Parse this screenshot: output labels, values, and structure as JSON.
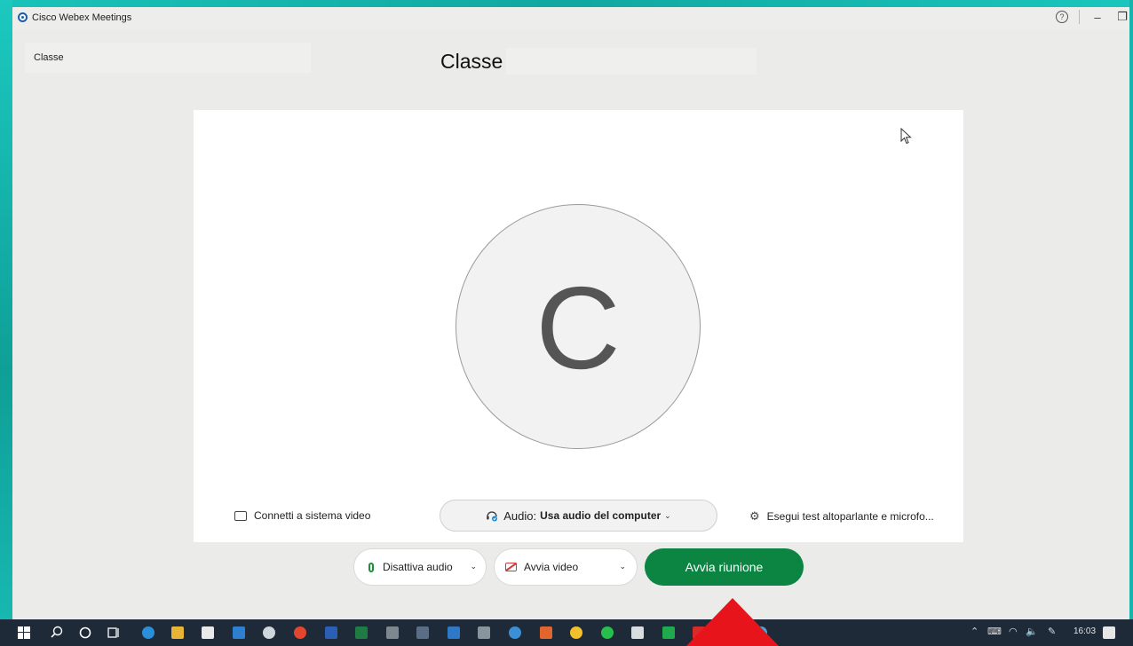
{
  "window": {
    "app_title": "Cisco Webex Meetings",
    "help_symbol": "?",
    "minimize_symbol": "–",
    "restore_symbol": "❐"
  },
  "meeting": {
    "sidebar_label": "Classe",
    "title": "Classe ",
    "avatar_initial": "C"
  },
  "panel": {
    "connect_label": "Connetti a sistema video",
    "audio_label": "Audio:",
    "audio_value": "Usa audio del computer",
    "test_label": "Esegui test altoparlante e microfo..."
  },
  "controls": {
    "mute_label": "Disattiva audio",
    "video_label": "Avvia video",
    "start_label": "Avvia riunione"
  },
  "taskbar": {
    "clock": "16:03"
  },
  "colors": {
    "desktop": "#13b5ad",
    "start_button": "#0c8542",
    "annotation_arrow": "#e8141b",
    "mic_icon": "#1d8f3c",
    "video_off_icon": "#d23b3b"
  }
}
